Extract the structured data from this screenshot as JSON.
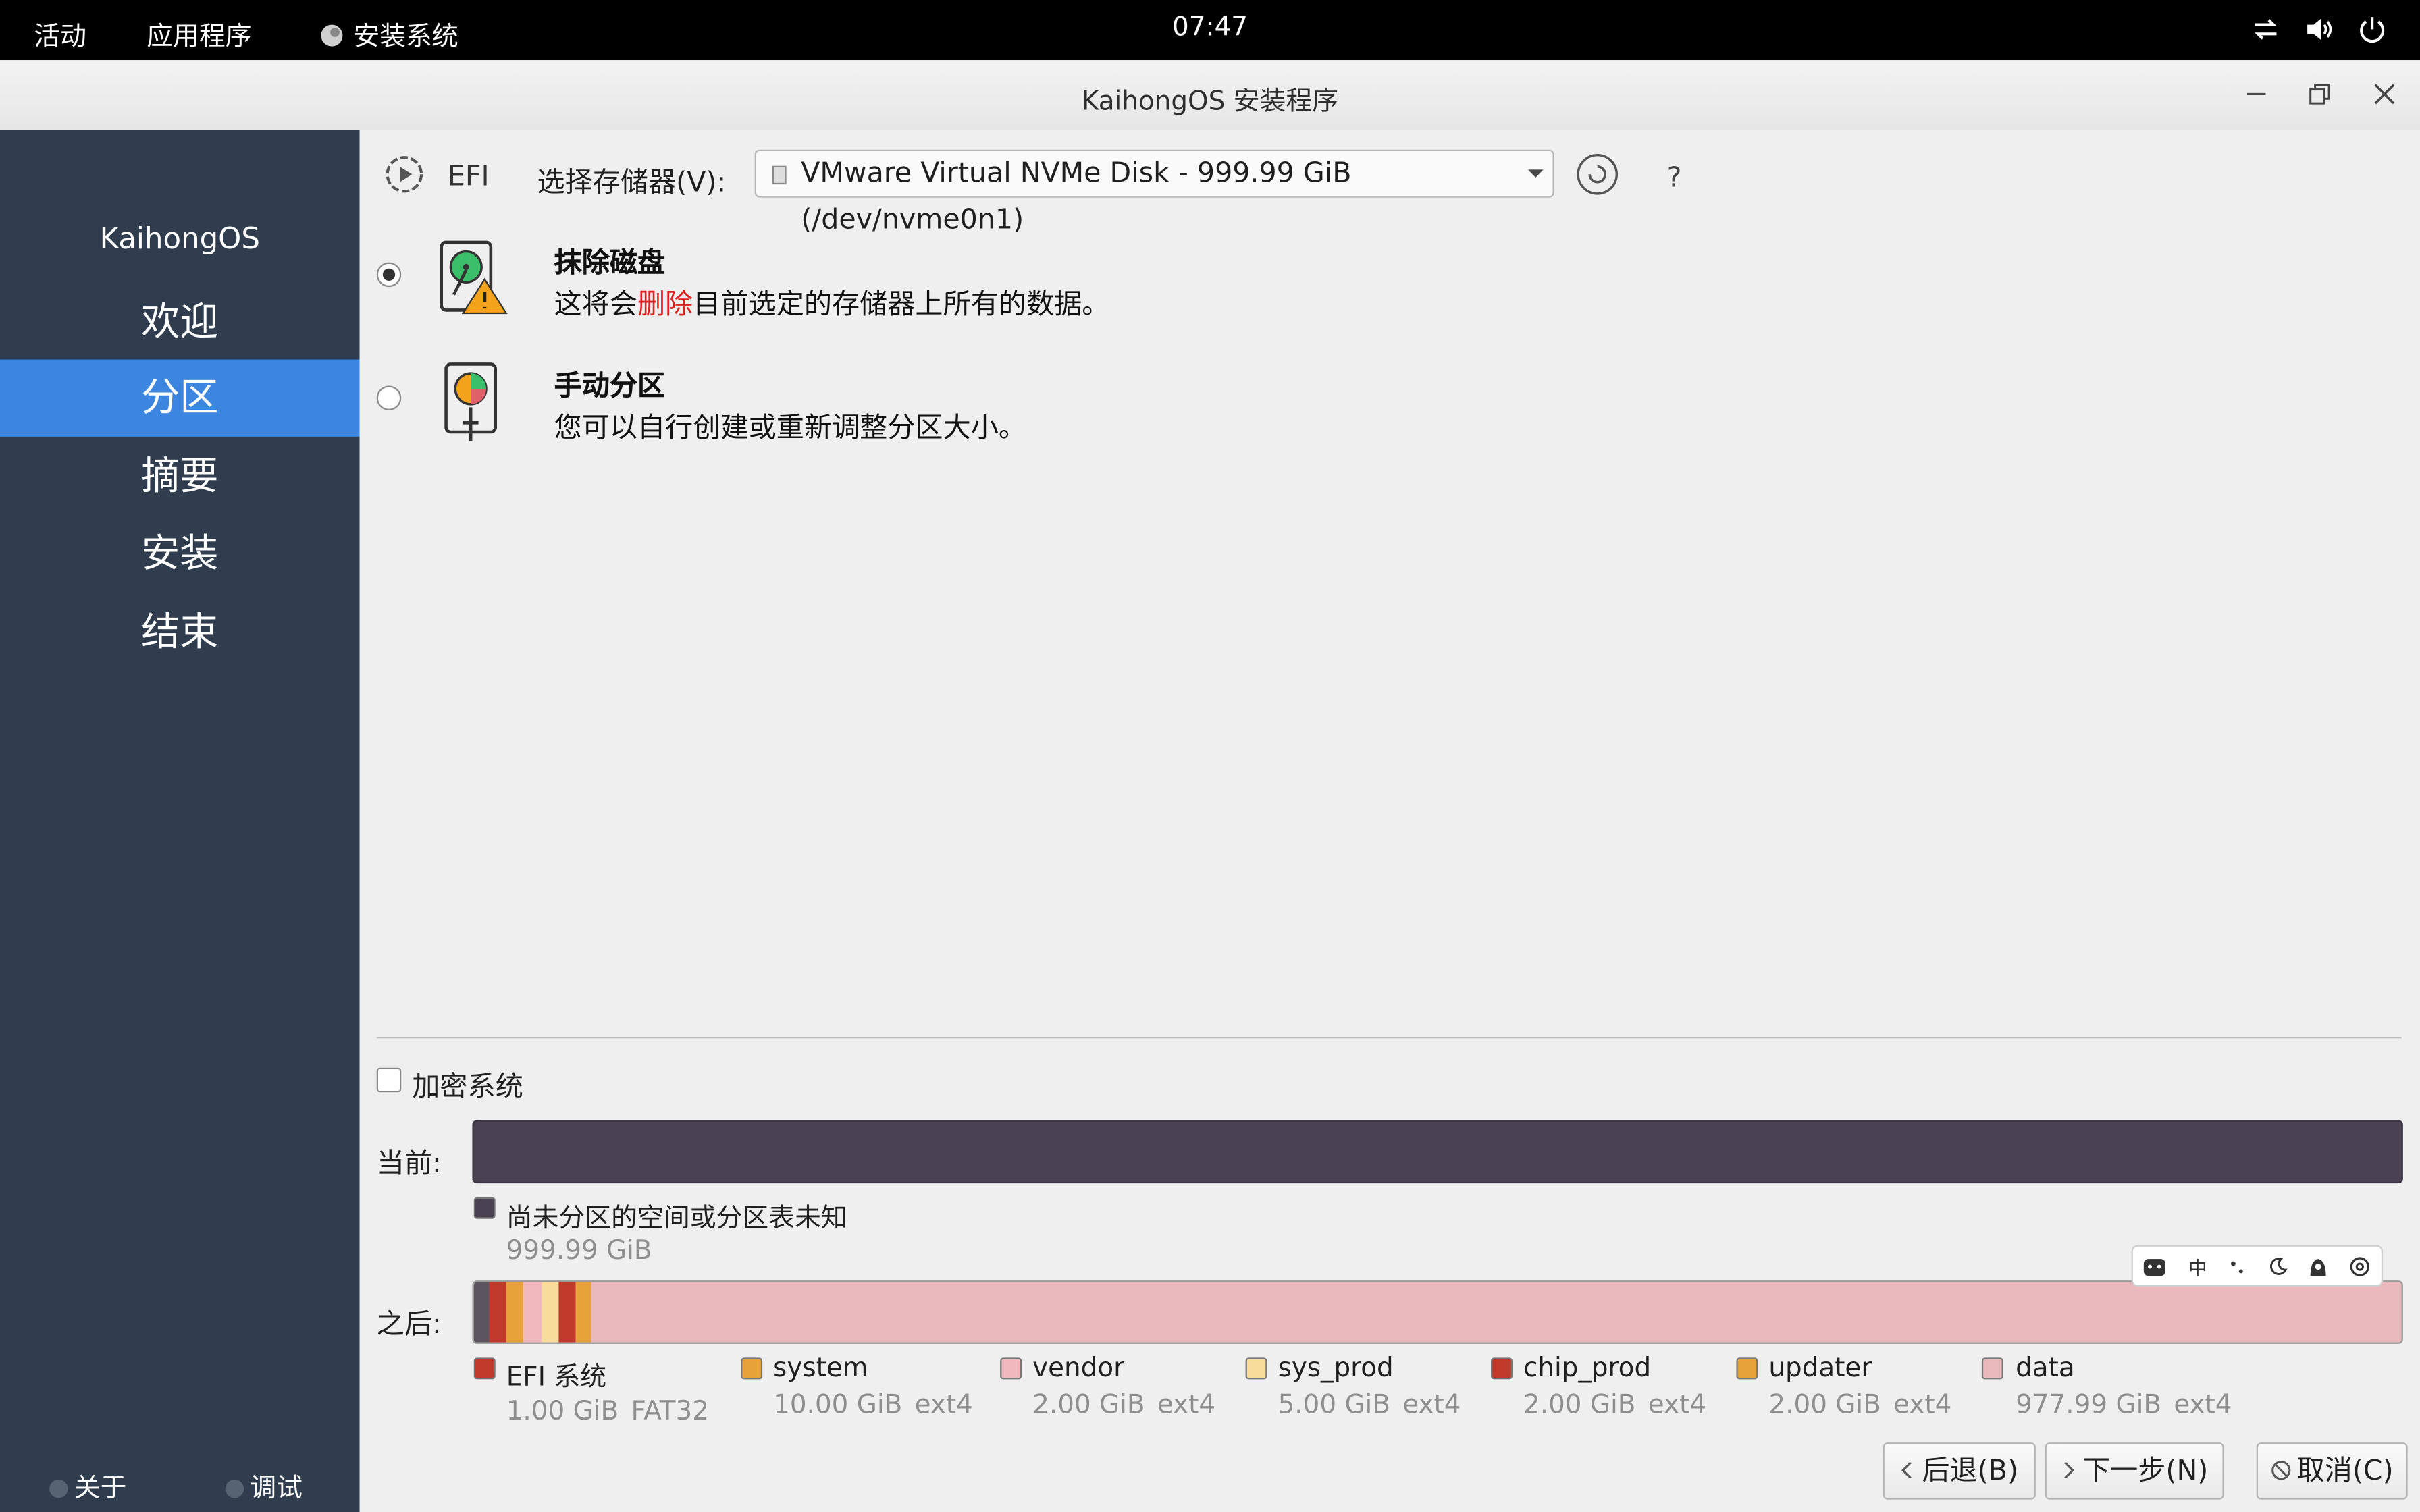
{
  "topbar": {
    "activities": "活动",
    "applications": "应用程序",
    "app_name": "安装系统",
    "clock": "07:47"
  },
  "window": {
    "title": "KaihongOS 安装程序"
  },
  "sidebar": {
    "brand": "KaihongOS",
    "items": [
      {
        "label": "欢迎",
        "active": false
      },
      {
        "label": "分区",
        "active": true
      },
      {
        "label": "摘要",
        "active": false
      },
      {
        "label": "安装",
        "active": false
      },
      {
        "label": "结束",
        "active": false
      }
    ],
    "footer": {
      "about": "关于",
      "debug": "调试"
    }
  },
  "toolbar": {
    "boot_mode": "EFI",
    "storage_label": "选择存储器(V):",
    "storage_value": "VMware Virtual NVMe Disk - 999.99 GiB (/dev/nvme0n1)",
    "help": "?"
  },
  "options": [
    {
      "title": "抹除磁盘",
      "desc_pre": "这将会",
      "desc_highlight": "删除",
      "desc_post": "目前选定的存储器上所有的数据。",
      "selected": true
    },
    {
      "title": "手动分区",
      "desc": "您可以自行创建或重新调整分区大小。",
      "selected": false
    }
  ],
  "encrypt": {
    "label": "加密系统",
    "checked": false
  },
  "current": {
    "label": "当前:",
    "color": "#4a4252",
    "legend_name": "尚未分区的空间或分区表未知",
    "legend_size": "999.99 GiB"
  },
  "after": {
    "label": "之后:",
    "partitions": [
      {
        "name": "EFI 系统",
        "size": "1.00 GiB",
        "fs": "FAT32",
        "color": "#c0392b"
      },
      {
        "name": "system",
        "size": "10.00 GiB",
        "fs": "ext4",
        "color": "#e8a23a"
      },
      {
        "name": "vendor",
        "size": "2.00 GiB",
        "fs": "ext4",
        "color": "#f0b9bd"
      },
      {
        "name": "sys_prod",
        "size": "5.00 GiB",
        "fs": "ext4",
        "color": "#f7dc9c"
      },
      {
        "name": "chip_prod",
        "size": "2.00 GiB",
        "fs": "ext4",
        "color": "#c0392b"
      },
      {
        "name": "updater",
        "size": "2.00 GiB",
        "fs": "ext4",
        "color": "#e8a23a"
      },
      {
        "name": "data",
        "size": "977.99 GiB",
        "fs": "ext4",
        "color": "#eab9bd"
      }
    ]
  },
  "buttons": {
    "back": "后退(B)",
    "next": "下一步(N)",
    "cancel": "取消(C)"
  },
  "ime": {
    "mode": "中"
  }
}
